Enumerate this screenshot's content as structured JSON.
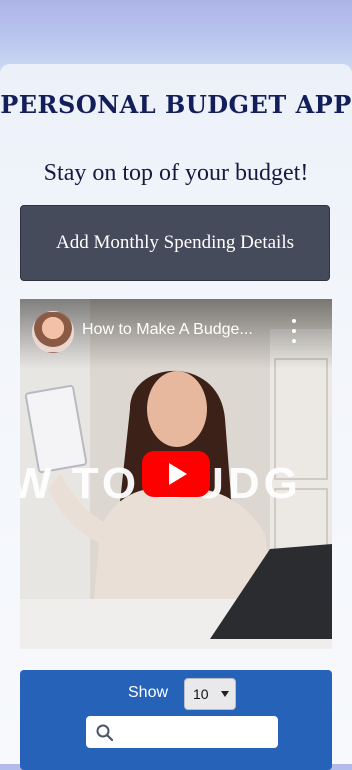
{
  "header": {
    "title": "PERSONAL BUDGET APP",
    "subtitle": "Stay on top of your budget!"
  },
  "actions": {
    "add_button_label": "Add Monthly Spending Details"
  },
  "video": {
    "title": "How to Make A Budge...",
    "overlay_text": "W TO BUDG",
    "play_icon": "play-icon",
    "menu_icon": "kebab-menu-icon"
  },
  "table_controls": {
    "show_label": "Show",
    "page_size_selected": "10",
    "search_placeholder": "",
    "search_icon": "search-icon",
    "accent_color": "#2562b8"
  }
}
